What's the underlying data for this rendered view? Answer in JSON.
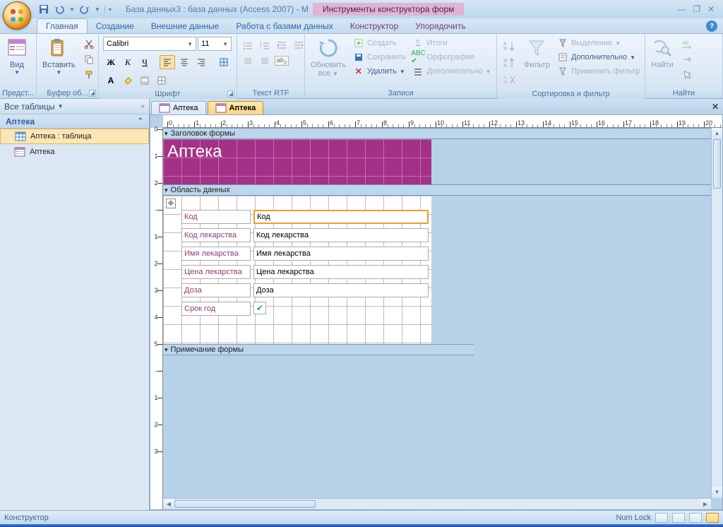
{
  "titlebar": {
    "title": "База данных3 : база данных (Access 2007) - M",
    "contextual_tab": "Инструменты конструктора форм"
  },
  "ribbon_tabs": [
    "Главная",
    "Создание",
    "Внешние данные",
    "Работа с базами данных",
    "Конструктор",
    "Упорядочить"
  ],
  "ribbon": {
    "views": {
      "label": "Предст...",
      "button": "Вид"
    },
    "clipboard": {
      "label": "Буфер об...",
      "paste": "Вставить"
    },
    "font": {
      "label": "Шрифт",
      "family": "Calibri",
      "size": "11"
    },
    "rtf": {
      "label": "Текст RTF"
    },
    "refresh": {
      "button": "Обновить",
      "button2": "все",
      "label": "Записи",
      "items": [
        "Создать",
        "Сохранить",
        "Удалить"
      ],
      "right": [
        "Итоги",
        "Орфография",
        "Дополнительно"
      ]
    },
    "sortfilter": {
      "label": "Сортировка и фильтр",
      "filter": "Фильтр",
      "items": [
        "Выделение",
        "Дополнительно",
        "Применить фильтр"
      ]
    },
    "find": {
      "label": "Найти",
      "button": "Найти"
    }
  },
  "navpane": {
    "header": "Все таблицы",
    "group": "Аптека",
    "items": [
      "Аптека : таблица",
      "Аптека"
    ]
  },
  "doctabs": [
    "Аптека",
    "Аптека"
  ],
  "form": {
    "sections": {
      "header": "Заголовок формы",
      "detail": "Область данных",
      "footer": "Примечание формы"
    },
    "title": "Аптека",
    "fields": [
      {
        "label": "Код",
        "bound": "Код"
      },
      {
        "label": "Код лекарства",
        "bound": "Код лекарства"
      },
      {
        "label": "Имя лекарства",
        "bound": "Имя лекарства"
      },
      {
        "label": "Цена лекарства",
        "bound": "Цена лекарства"
      },
      {
        "label": "Доза",
        "bound": "Доза"
      },
      {
        "label": "Срок год",
        "bound": ""
      }
    ]
  },
  "status": {
    "left": "Конструктор",
    "numlock": "Num Lock"
  }
}
